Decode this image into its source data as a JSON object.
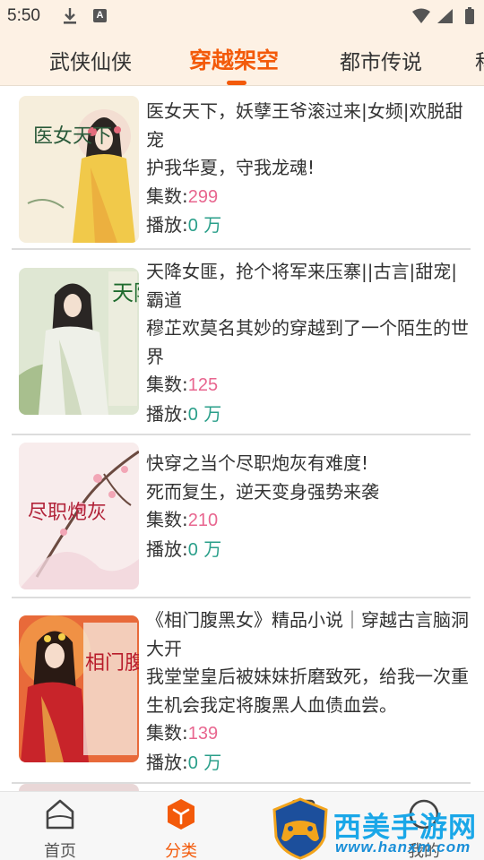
{
  "status_bar": {
    "time": "5:50",
    "badge_letter": "A"
  },
  "tabs": [
    {
      "label": "武侠仙侠",
      "active": false
    },
    {
      "label": "穿越架空",
      "active": true
    },
    {
      "label": "都市传说",
      "active": false
    },
    {
      "label": "科",
      "active": false
    }
  ],
  "list_labels": {
    "episodes": "集数:",
    "plays": "播放:",
    "plays_unit": " 万"
  },
  "books": [
    {
      "title": "医女天下，妖孽王爷滚过来|女频|欢脱甜宠",
      "desc": "护我华夏，守我龙魂!",
      "episodes": "299",
      "plays": "0",
      "cover_text": "医女天下"
    },
    {
      "title": "天降女匪，抢个将军来压寨||古言|甜宠|霸道",
      "desc": "穆芷欢莫名其妙的穿越到了一个陌生的世界",
      "episodes": "125",
      "plays": "0",
      "cover_text": "天降女匪"
    },
    {
      "title": "快穿之当个尽职炮灰有难度!",
      "desc": "死而复生，逆天变身强势来袭",
      "episodes": "210",
      "plays": "0",
      "cover_text": "尽职炮灰"
    },
    {
      "title": "《相门腹黑女》精品小说｜穿越古言脑洞大开",
      "desc": "我堂堂皇后被妹妹折磨致死，给我一次重生机会我定将腹黑人血债血尝。",
      "episodes": "139",
      "plays": "0",
      "cover_text": "相门腹黑女"
    }
  ],
  "bottom_nav": [
    {
      "label": "首页",
      "icon": "home-icon",
      "active": false
    },
    {
      "label": "分类",
      "icon": "category-cube-icon",
      "active": true
    },
    {
      "label": "",
      "icon": "bookshelf-icon",
      "active": false
    },
    {
      "label": "我的",
      "icon": "profile-icon",
      "active": false
    }
  ],
  "watermark": {
    "title": "西美手游网",
    "url": "www.hanxm.com"
  },
  "colors": {
    "accent": "#f35a0a",
    "episodes_value": "#e8668f",
    "plays_value": "#2a9f8a",
    "header_bg": "#fdf1e4"
  }
}
